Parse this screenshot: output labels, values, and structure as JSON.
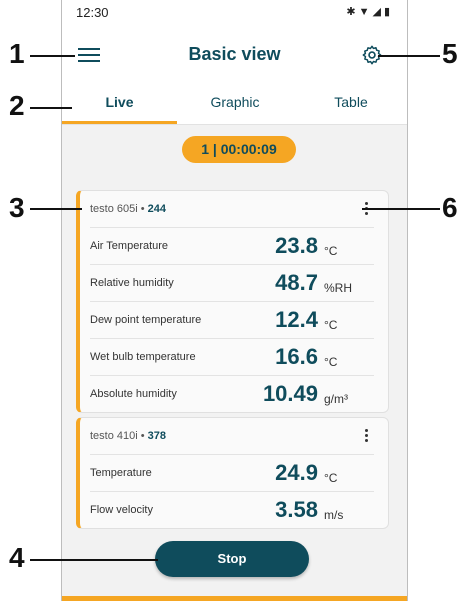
{
  "status_bar": {
    "time": "12:30",
    "icons": [
      "bluetooth-icon",
      "wifi-icon",
      "signal-icon",
      "battery-icon"
    ]
  },
  "app_bar": {
    "title": "Basic view"
  },
  "tabs": [
    {
      "label": "Live",
      "active": true
    },
    {
      "label": "Graphic",
      "active": false
    },
    {
      "label": "Table",
      "active": false
    }
  ],
  "timer": "1  |  00:00:09",
  "cards": [
    {
      "device": "testo 605i",
      "serial": "244",
      "rows": [
        {
          "label": "Air Temperature",
          "value": "23.8",
          "unit": "°C"
        },
        {
          "label": "Relative humidity",
          "value": "48.7",
          "unit": "%RH"
        },
        {
          "label": "Dew point temperature",
          "value": "12.4",
          "unit": "°C"
        },
        {
          "label": "Wet bulb temperature",
          "value": "16.6",
          "unit": "°C"
        },
        {
          "label": "Absolute humidity",
          "value": "10.49",
          "unit": "g/m³"
        }
      ]
    },
    {
      "device": "testo 410i",
      "serial": "378",
      "rows": [
        {
          "label": "Temperature",
          "value": "24.9",
          "unit": "°C"
        },
        {
          "label": "Flow velocity",
          "value": "3.58",
          "unit": "m/s"
        }
      ]
    }
  ],
  "stop_button": "Stop",
  "callouts": [
    "1",
    "2",
    "3",
    "4",
    "5",
    "6"
  ],
  "colors": {
    "accent": "#f5a623",
    "primary": "#0f4c5c"
  }
}
